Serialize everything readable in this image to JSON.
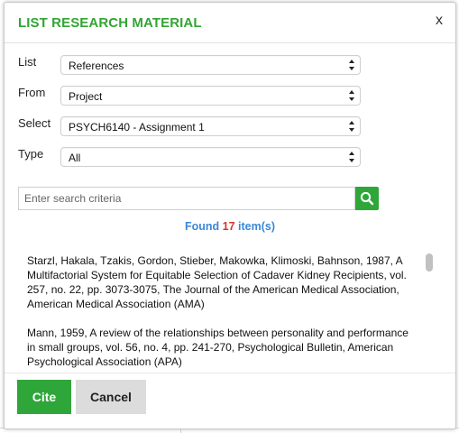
{
  "dialog": {
    "title": "LIST RESEARCH MATERIAL",
    "close_label": "x"
  },
  "filters": [
    {
      "label": "List",
      "value": "References"
    },
    {
      "label": "From",
      "value": "Project"
    },
    {
      "label": "Select",
      "value": "PSYCH6140 - Assignment 1"
    },
    {
      "label": "Type",
      "value": "All"
    }
  ],
  "search": {
    "placeholder": "Enter search criteria",
    "value": "",
    "icon": "search-icon"
  },
  "found": {
    "prefix": "Found",
    "count": "17",
    "suffix": "item(s)"
  },
  "results": [
    "Starzl, Hakala, Tzakis, Gordon, Stieber, Makowka, Klimoski, Bahnson, 1987, A Multifactorial System for Equitable Selection of Cadaver Kidney Recipients, vol. 257, no. 22, pp. 3073-3075, The Journal of the American Medical Association, American Medical Association (AMA)",
    "Mann, 1959, A review of the relationships between personality and performance in small groups, vol. 56, no. 4, pp. 241-270, Psychological Bulletin, American Psychological Association (APA)"
  ],
  "buttons": {
    "cite": "Cite",
    "cancel": "Cancel"
  },
  "colors": {
    "accent_green": "#2fa63a",
    "title_green": "#32a533",
    "found_blue": "#3b87d8",
    "count_red": "#d9332b"
  }
}
